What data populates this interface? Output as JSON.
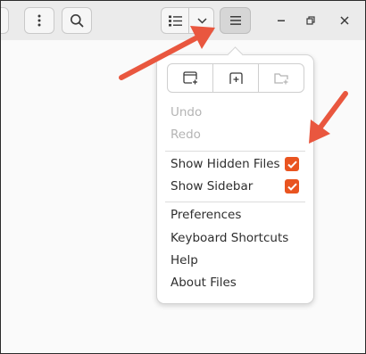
{
  "header": {
    "icons": {
      "kebab": "vertical-ellipsis-icon",
      "search": "search-icon",
      "view": "list-view-icon",
      "view_options": "chevron-down-icon",
      "main_menu": "hamburger-menu-icon",
      "minimize": "minimize-icon",
      "maximize": "maximize-icon",
      "close": "close-icon"
    }
  },
  "menu": {
    "new_actions": [
      {
        "icon": "new-window-icon",
        "enabled": true
      },
      {
        "icon": "new-tab-icon",
        "enabled": true
      },
      {
        "icon": "new-folder-icon",
        "enabled": false
      }
    ],
    "undo_label": "Undo",
    "redo_label": "Redo",
    "show_hidden_label": "Show Hidden Files",
    "show_hidden_checked": true,
    "show_sidebar_label": "Show Sidebar",
    "show_sidebar_checked": true,
    "preferences_label": "Preferences",
    "shortcuts_label": "Keyboard Shortcuts",
    "help_label": "Help",
    "about_label": "About Files"
  },
  "colors": {
    "accent": "#e95420",
    "annotation_arrow": "#e9573f",
    "disabled_text": "#b4b4b4"
  }
}
